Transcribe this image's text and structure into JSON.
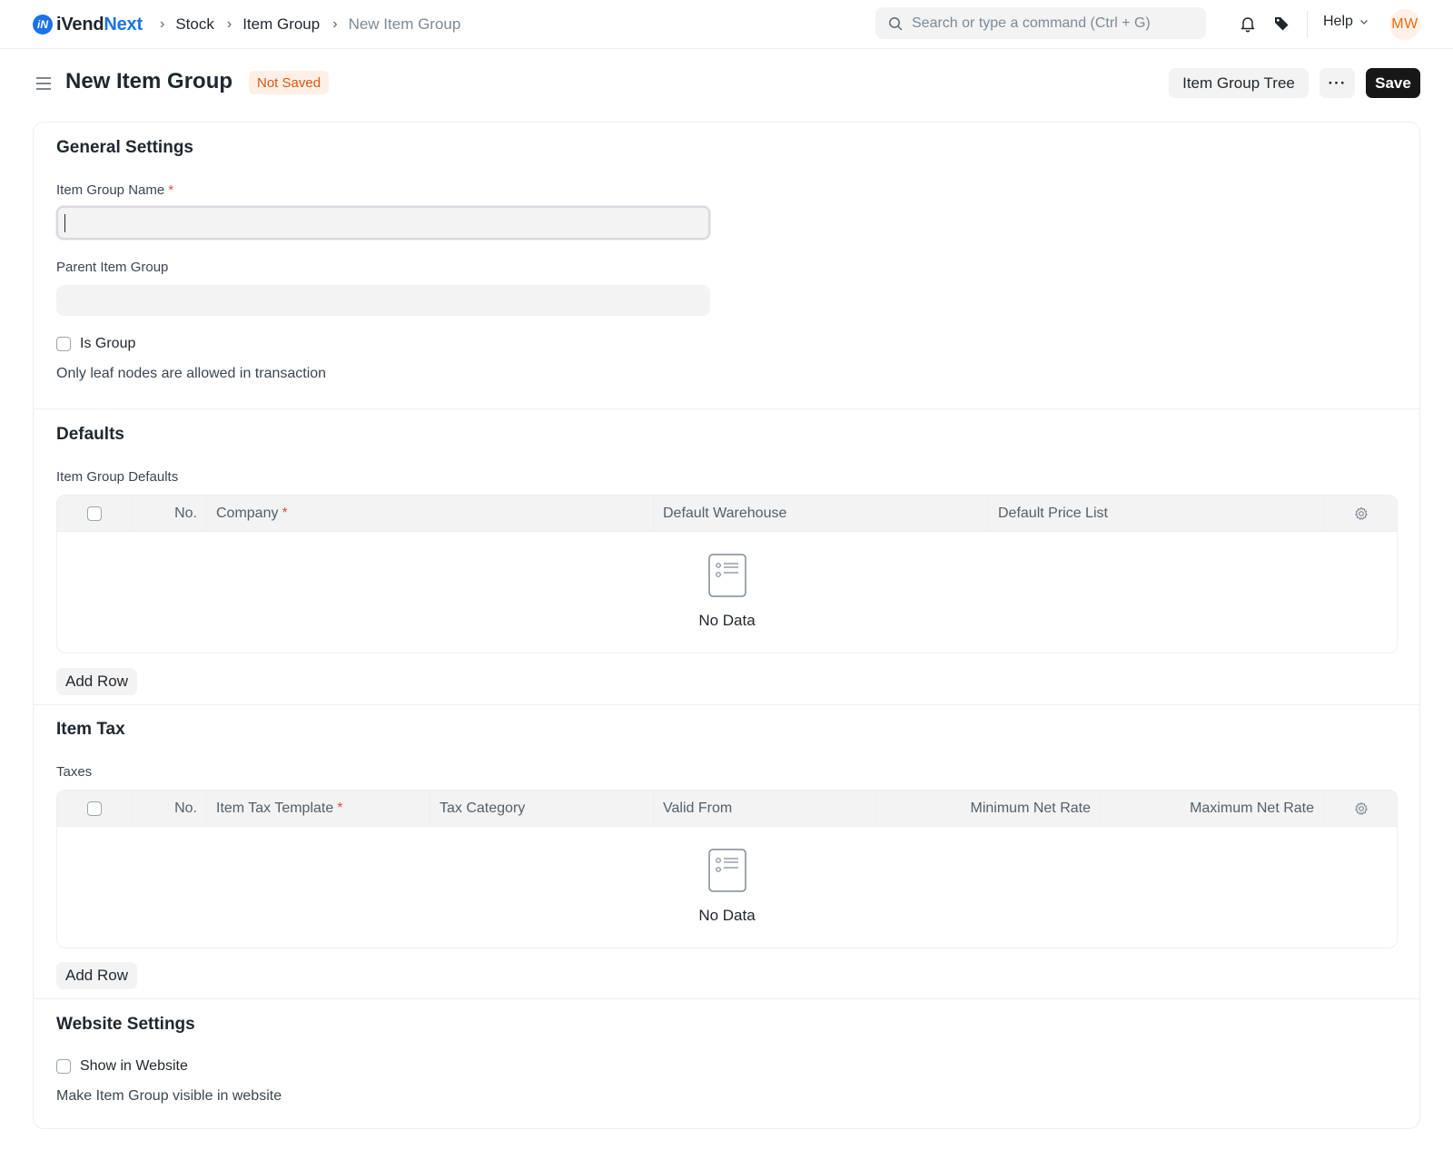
{
  "navbar": {
    "logo_prefix": "iVend",
    "logo_suffix": "Next",
    "logo_mark": "iN",
    "breadcrumbs": [
      "Stock",
      "Item Group",
      "New Item Group"
    ],
    "search_placeholder": "Search or type a command (Ctrl + G)",
    "help_label": "Help",
    "avatar_initials": "MW"
  },
  "page": {
    "title": "New Item Group",
    "status": "Not Saved",
    "tree_button": "Item Group Tree",
    "more_button": "···",
    "save_button": "Save"
  },
  "general": {
    "title": "General Settings",
    "item_group_name_label": "Item Group Name",
    "item_group_name_value": "",
    "parent_label": "Parent Item Group",
    "parent_value": "",
    "is_group_label": "Is Group",
    "is_group_hint": "Only leaf nodes are allowed in transaction"
  },
  "defaults": {
    "title": "Defaults",
    "table_label": "Item Group Defaults",
    "columns": {
      "no": "No.",
      "company": "Company",
      "warehouse": "Default Warehouse",
      "price_list": "Default Price List"
    },
    "empty_text": "No Data",
    "add_row": "Add Row"
  },
  "item_tax": {
    "title": "Item Tax",
    "table_label": "Taxes",
    "columns": {
      "no": "No.",
      "template": "Item Tax Template",
      "category": "Tax Category",
      "valid_from": "Valid From",
      "min_rate": "Minimum Net Rate",
      "max_rate": "Maximum Net Rate"
    },
    "empty_text": "No Data",
    "add_row": "Add Row"
  },
  "website": {
    "title": "Website Settings",
    "show_label": "Show in Website",
    "show_hint": "Make Item Group visible in website"
  },
  "icons": [
    "logo-icon",
    "chevron-right-icon",
    "search-icon",
    "bell-icon",
    "tag-icon",
    "chevron-down-icon",
    "hamburger-menu-icon",
    "gear-icon",
    "empty-list-icon"
  ],
  "colors": {
    "brand": "#1a73e8",
    "status_text": "#e0540c",
    "status_bg": "#fff0e6",
    "primary_button": "#171717",
    "required_marker": "#e24c4c"
  }
}
